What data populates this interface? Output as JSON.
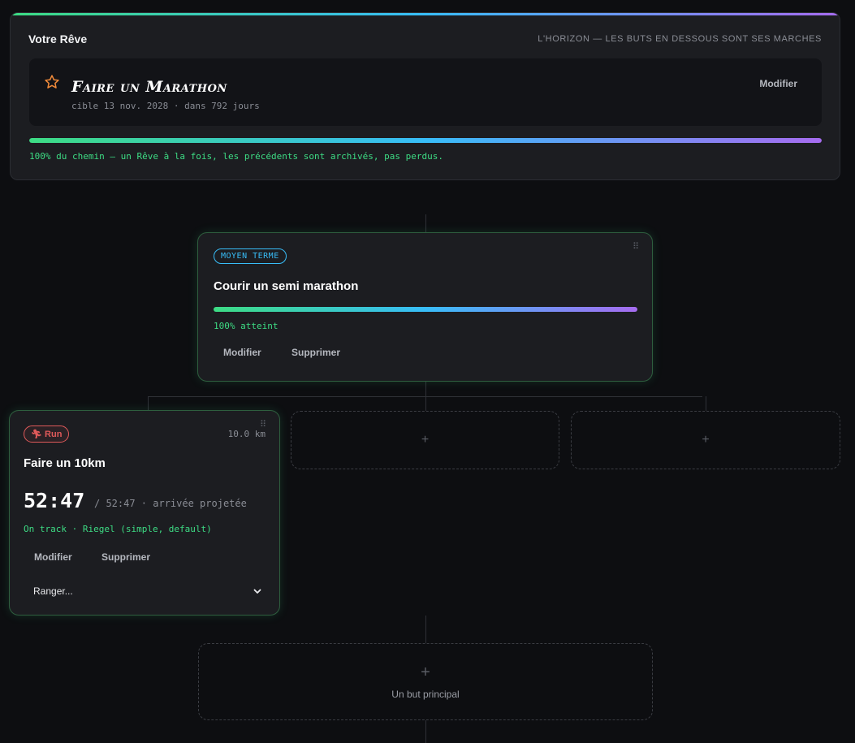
{
  "dream": {
    "title": "Votre Rêve",
    "horizon": "L'HORIZON — LES BUTS EN DESSOUS SONT SES MARCHES",
    "goal_name": "Faire un Marathon",
    "goal_sub": "cible 13 nov. 2028 · dans 792 jours",
    "edit_label": "Modifier",
    "progress_fraction": 1.0,
    "note": "100% du chemin — un Rêve à la fois, les précédents sont archivés, pas perdus."
  },
  "mid_goal": {
    "tag": "MOYEN TERME",
    "title": "Courir un semi marathon",
    "progress_fraction": 1.0,
    "note": "100% atteint",
    "edit_label": "Modifier",
    "delete_label": "Supprimer"
  },
  "run_goal": {
    "tag": "Run",
    "distance": "10.0 km",
    "title": "Faire un 10km",
    "time": "52:47",
    "projection": "/ 52:47 · arrivée projetée",
    "status": "On track · Riegel (simple, default)",
    "edit_label": "Modifier",
    "delete_label": "Supprimer",
    "select_value": "Ranger..."
  },
  "slots": {
    "plus": "+",
    "main_goal_label": "Un but principal"
  },
  "colors": {
    "accent_green": "#3ddc84",
    "accent_blue": "#38bdf8",
    "accent_purple": "#a66cf0",
    "run_red": "#e05a5a",
    "star_orange": "#f08a3a"
  },
  "icons": {
    "star": "star-icon",
    "run": "runner-icon",
    "drag": "drag-handle-icon",
    "chevron": "chevron-down-icon"
  }
}
